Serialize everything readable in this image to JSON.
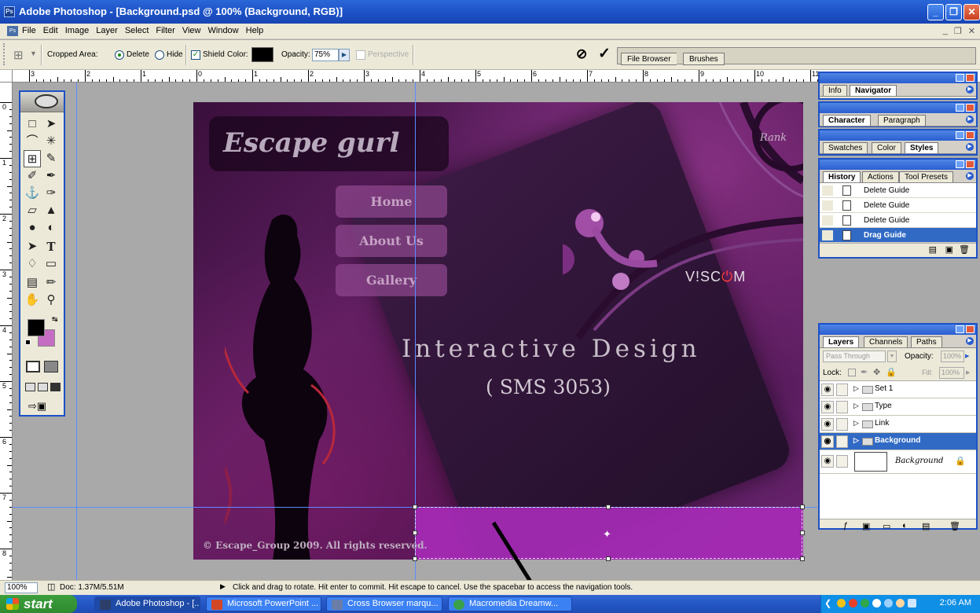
{
  "window": {
    "title": "Adobe Photoshop - [Background.psd @ 100% (Background, RGB)]",
    "controls": [
      "_",
      "❐",
      "✕"
    ]
  },
  "menu": [
    "File",
    "Edit",
    "Image",
    "Layer",
    "Select",
    "Filter",
    "View",
    "Window",
    "Help"
  ],
  "mdi_controls": [
    "_",
    "❐",
    "✕"
  ],
  "options": {
    "cropped_area_label": "Cropped Area:",
    "delete_label": "Delete",
    "hide_label": "Hide",
    "shield_label": "Shield",
    "color_label": "Color:",
    "shield_color": "#000000",
    "opacity_label": "Opacity:",
    "opacity_value": "75%",
    "perspective_label": "Perspective",
    "palette_well_tabs": [
      "File Browser",
      "Brushes"
    ]
  },
  "rulers": {
    "horizontal": [
      "3",
      "2",
      "1",
      "0",
      "1",
      "2",
      "3",
      "4",
      "5",
      "6",
      "7",
      "8",
      "9",
      "10",
      "11"
    ],
    "vertical": [
      "0",
      "1",
      "2",
      "3",
      "4",
      "5",
      "6",
      "7",
      "8"
    ]
  },
  "canvas": {
    "logo": "Escape gurl",
    "nav": [
      "Home",
      "About Us",
      "Gallery"
    ],
    "brand": {
      "prefix": "V!SC",
      "mark": "⏻",
      "suffix": "M"
    },
    "title_line1": "Interactive Design",
    "title_line2": "( SMS 3053)",
    "copyright": "© Escape_Group 2009. All rights reserved.",
    "corner_text": "Rank"
  },
  "toolbox": {
    "foreground_color": "#000000",
    "background_color": "#c46dc2"
  },
  "palettes": {
    "navigator_tabs": [
      "Info",
      "Navigator"
    ],
    "character_tabs": [
      "Character",
      "Paragraph"
    ],
    "styles_tabs": [
      "Swatches",
      "Color",
      "Styles"
    ],
    "history_tabs": [
      "History",
      "Actions",
      "Tool Presets"
    ],
    "history_items": [
      "Delete Guide",
      "Delete Guide",
      "Delete Guide",
      "Drag Guide"
    ],
    "layers_tabs": [
      "Layers",
      "Channels",
      "Paths"
    ],
    "blend_mode": "Pass Through",
    "opacity_label": "Opacity:",
    "opacity_value": "100%",
    "lock_label": "Lock:",
    "fill_label": "Fill:",
    "fill_value": "100%",
    "layers": [
      "Set 1",
      "Type",
      "Link",
      "Background",
      "Background"
    ]
  },
  "status": {
    "zoom": "100%",
    "doc": "Doc: 1.37M/5.51M",
    "hint": "Click and drag to rotate. Hit enter to commit. Hit escape to cancel. Use the spacebar to access the navigation tools."
  },
  "taskbar": {
    "start": "start",
    "tasks": [
      "Adobe Photoshop - [...",
      "Microsoft PowerPoint ...",
      "Cross Browser marqu...",
      "Macromedia Dreamw..."
    ],
    "clock": "2:06 AM"
  }
}
